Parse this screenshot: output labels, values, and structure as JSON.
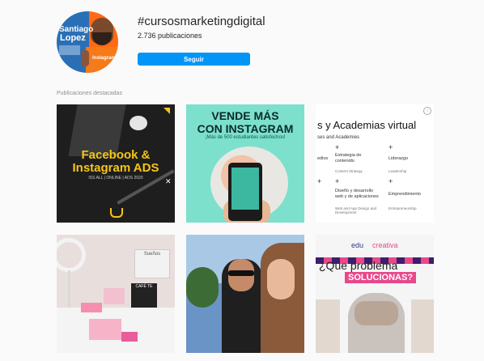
{
  "profile": {
    "handle": "#cursosmarketingdigital",
    "count": "2.736 publicaciones",
    "follow_label": "Seguir",
    "avatar": {
      "name_line1": "Santiago",
      "name_line2": "Lopez",
      "brand": "Instagram"
    }
  },
  "section_label": "Publicaciones destacadas",
  "posts": [
    {
      "title1": "Facebook &",
      "title2": "Instagram ADS",
      "subtitle": "ISS ALL | ONLINE | ADS 2020"
    },
    {
      "line1": "VENDE MÁS",
      "line2": "CON INSTAGRAM",
      "line3": "¡Más de 500 estudiantes satisfechos!"
    },
    {
      "header": "s y Academias virtual",
      "subheader": "ses and Academies",
      "items": [
        {
          "label": "edios",
          "small": ""
        },
        {
          "label": "Estrategia de contenido",
          "small": "Content Strategy"
        },
        {
          "label": "Liderazgo",
          "small": "Leadership"
        },
        {
          "label": "Diseño y desarrollo web y de aplicaciones",
          "small": "Web and App Design and Development"
        },
        {
          "label": "Emprendimiento",
          "small": "Entrepreneurship"
        }
      ]
    },
    {
      "sign_text": "Sueños",
      "letter_text": "CAFÉ TE"
    },
    {},
    {
      "logo_part1": "edu",
      "logo_part2": "creativa",
      "line1": "¿Que problema",
      "line2": "SOLUCIONAS?"
    }
  ],
  "colors": {
    "follow": "#0095f6",
    "background": "#fafafa"
  }
}
